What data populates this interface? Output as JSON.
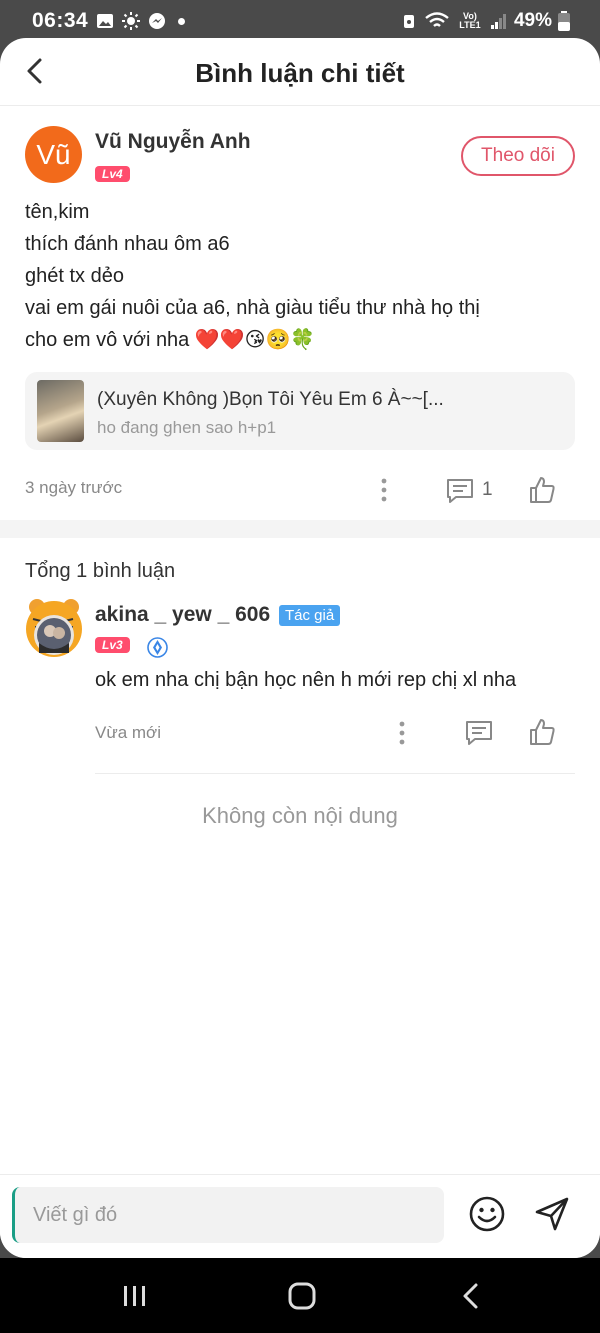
{
  "status": {
    "time": "06:34",
    "battery": "49%",
    "network": "Vo) LTE1"
  },
  "header": {
    "title": "Bình luận chi tiết"
  },
  "post": {
    "author": {
      "avatar_text": "Vũ",
      "name": "Vũ Nguyễn Anh",
      "level": "Lv4",
      "follow_label": "Theo dõi"
    },
    "lines": [
      "tên,kim",
      "thích đánh nhau ôm a6",
      "ghét tx dẻo",
      "vai em gái nuôi của a6, nhà giàu tiểu thư nhà họ thị",
      "cho em vô với nha ❤️❤️😘🥺🍀"
    ],
    "book": {
      "title": "(Xuyên Không )Bọn Tôi Yêu Em 6 À~~[...",
      "subtitle": "ho đang ghen sao h+p1"
    },
    "time": "3 ngày trước",
    "comment_count": "1"
  },
  "comments_section": {
    "total_label": "Tổng 1 bình luận",
    "items": [
      {
        "name": "akina _ yew _ 606",
        "badge": "Tác giả",
        "level": "Lv3",
        "text": "ok em nha chị bận học nên h mới rep chị xl nha",
        "time": "Vừa mới"
      }
    ],
    "end_label": "Không còn nội dung"
  },
  "composer": {
    "placeholder": "Viết gì đó"
  },
  "colors": {
    "accent": "#e0566a",
    "level_badge": "#ff4d6d",
    "author_badge": "#4aa3f0",
    "avatar_orange": "#f26a1b"
  }
}
